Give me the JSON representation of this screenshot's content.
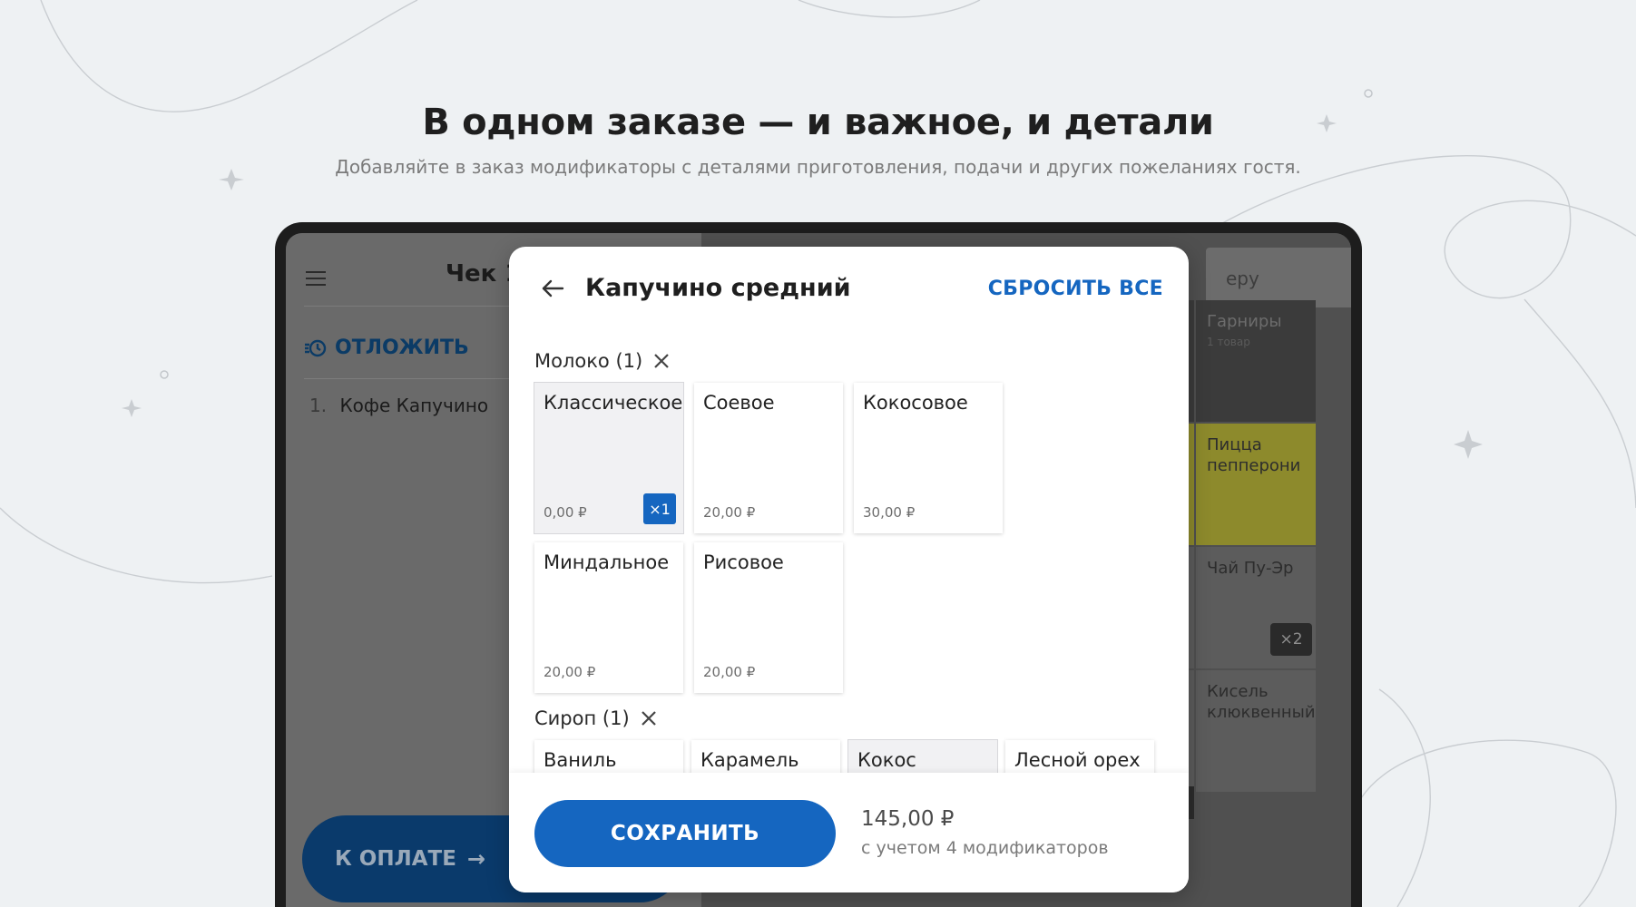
{
  "hero": {
    "title": "В одном заказе — и важное, и детали",
    "subtitle": "Добавляйте в заказ модификаторы с деталями приготовления, подачи и других пожеланиях гостя."
  },
  "pos": {
    "check_title": "Чек 1",
    "postpone_label": "ОТЛОЖИТЬ",
    "order_items": [
      {
        "num": "1.",
        "name": "Кофе Капучино"
      }
    ],
    "pay_label": "К ОПЛАТЕ",
    "search_placeholder": "еру",
    "tiles": [
      {
        "name": "Гарниры",
        "sub": "1 товар"
      },
      {
        "name": "Пицца пепперони"
      },
      {
        "name": "Чай Пу-Эр",
        "badge": "×2"
      },
      {
        "name": "Кисель клюквенный"
      }
    ],
    "colors": {
      "tile_dark": "#3b3b3b",
      "tile_yellow": "#8d8a2c",
      "tile_gray": "#5c5c5c"
    }
  },
  "modal": {
    "title": "Капучино средний",
    "reset_label": "СБРОСИТЬ ВСЕ",
    "groups": [
      {
        "label": "Молоко (1)",
        "options": [
          {
            "name": "Классическое",
            "price": "0,00 ₽",
            "qty": "×1",
            "selected": true
          },
          {
            "name": "Соевое",
            "price": "20,00 ₽"
          },
          {
            "name": "Кокосовое",
            "price": "30,00 ₽"
          },
          {
            "name": "Миндальное",
            "price": "20,00 ₽"
          },
          {
            "name": "Рисовое",
            "price": "20,00 ₽"
          }
        ]
      },
      {
        "label": "Сироп (1)",
        "options": [
          {
            "name": "Ваниль"
          },
          {
            "name": "Карамель"
          },
          {
            "name": "Кокос",
            "selected": true
          },
          {
            "name": "Лесной орех"
          }
        ]
      }
    ],
    "save_label": "СОХРАНИТЬ",
    "total": "145,00 ₽",
    "total_note": "с учетом 4 модификаторов",
    "accent_color": "#1566c0"
  }
}
